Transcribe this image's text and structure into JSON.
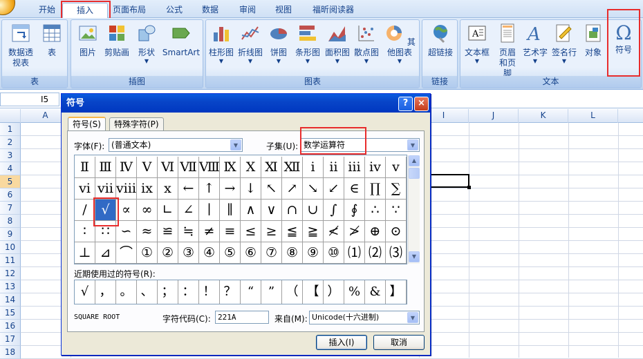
{
  "tabs": [
    "开始",
    "插入",
    "页面布局",
    "公式",
    "数据",
    "审阅",
    "视图",
    "福昕阅读器"
  ],
  "ribbon": {
    "groups": [
      {
        "label": "表",
        "buttons": [
          {
            "label": "数据透视表",
            "sub": "▾"
          },
          {
            "label": "表"
          }
        ]
      },
      {
        "label": "插图",
        "buttons": [
          {
            "label": "图片"
          },
          {
            "label": "剪贴画"
          },
          {
            "label": "形状"
          },
          {
            "label": "SmartArt"
          }
        ]
      },
      {
        "label": "图表",
        "buttons": [
          {
            "label": "柱形图"
          },
          {
            "label": "折线图"
          },
          {
            "label": "饼图"
          },
          {
            "label": "条形图"
          },
          {
            "label": "面积图"
          },
          {
            "label": "散点图"
          },
          {
            "label": "其他图表"
          }
        ]
      },
      {
        "label": "链接",
        "buttons": [
          {
            "label": "超链接"
          }
        ]
      },
      {
        "label": "文本",
        "buttons": [
          {
            "label": "文本框"
          },
          {
            "label": "页眉和页脚"
          },
          {
            "label": "艺术字"
          },
          {
            "label": "签名行"
          },
          {
            "label": "对象"
          },
          {
            "label": "符号"
          }
        ]
      }
    ]
  },
  "formula_bar": {
    "cell_ref": "I5",
    "value": ""
  },
  "columns": [
    "A",
    "I",
    "J",
    "K",
    "L"
  ],
  "rows": [
    "1",
    "2",
    "3",
    "4",
    "5",
    "6",
    "7",
    "8",
    "9",
    "10",
    "11",
    "12",
    "13",
    "14",
    "15",
    "16",
    "17",
    "18"
  ],
  "dialog": {
    "title": "符号",
    "help": "?",
    "close": "×",
    "tabs": [
      "符号(S)",
      "特殊字符(P)"
    ],
    "font_label": "字体(F):",
    "font_value": "(普通文本)",
    "subset_label": "子集(U):",
    "subset_value": "数学运算符",
    "symbols": [
      [
        "Ⅱ",
        "Ⅲ",
        "Ⅳ",
        "Ⅴ",
        "Ⅵ",
        "Ⅶ",
        "Ⅷ",
        "Ⅸ",
        "Ⅹ",
        "Ⅺ",
        "Ⅻ",
        "ⅰ",
        "ⅱ",
        "ⅲ",
        "ⅳ",
        "ⅴ"
      ],
      [
        "ⅵ",
        "ⅶ",
        "ⅷ",
        "ⅸ",
        "ⅹ",
        "←",
        "↑",
        "→",
        "↓",
        "↖",
        "↗",
        "↘",
        "↙",
        "∈",
        "∏",
        "∑"
      ],
      [
        "∕",
        "√",
        "∝",
        "∞",
        "∟",
        "∠",
        "∣",
        "∥",
        "∧",
        "∨",
        "∩",
        "∪",
        "∫",
        "∮",
        "∴",
        "∵"
      ],
      [
        "∶",
        "∷",
        "∽",
        "≈",
        "≌",
        "≒",
        "≠",
        "≡",
        "≤",
        "≥",
        "≦",
        "≧",
        "≮",
        "≯",
        "⊕",
        "⊙"
      ],
      [
        "⊥",
        "⊿",
        "⌒",
        "①",
        "②",
        "③",
        "④",
        "⑤",
        "⑥",
        "⑦",
        "⑧",
        "⑨",
        "⑩",
        "⑴",
        "⑵",
        "⑶"
      ]
    ],
    "recent_label": "近期使用过的符号(R):",
    "recent": [
      "√",
      "，",
      "。",
      "、",
      "；",
      "：",
      "！",
      "？",
      "“",
      "”",
      "（",
      "【",
      "）",
      "%",
      "&",
      "】"
    ],
    "char_name": "SQUARE ROOT",
    "code_label": "字符代码(C):",
    "code_value": "221A",
    "from_label": "来自(M):",
    "from_value": "Unicode(十六进制)",
    "insert_label": "插入(I)",
    "cancel_label": "取消"
  }
}
